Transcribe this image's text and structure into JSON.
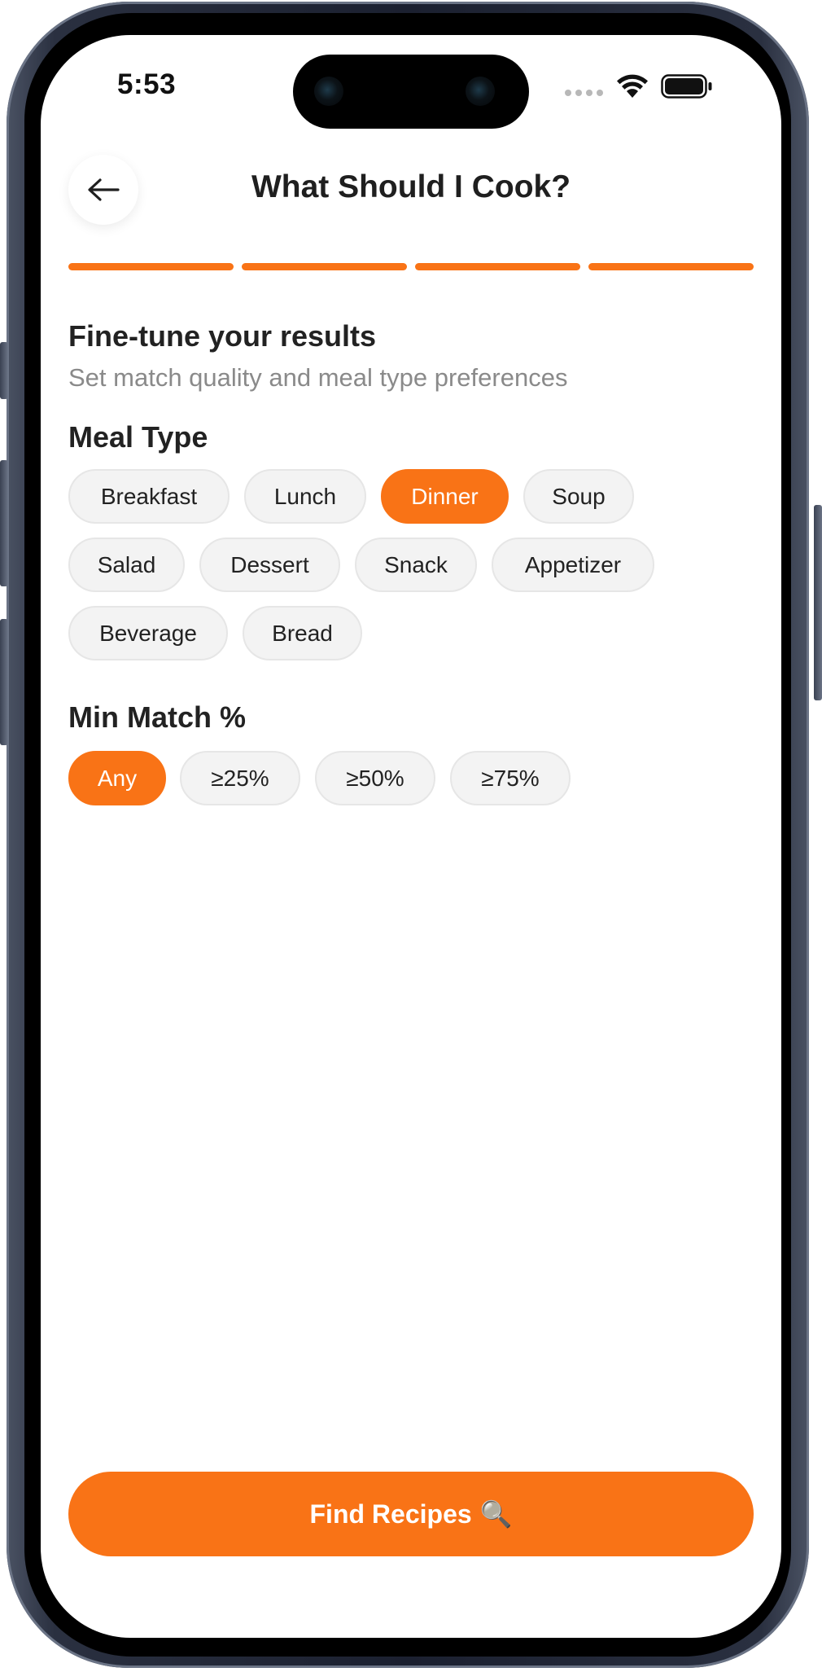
{
  "status_bar": {
    "time": "5:53"
  },
  "header": {
    "title": "What Should I Cook?",
    "back_icon": "arrow-left-icon"
  },
  "progress": {
    "steps_total": 4,
    "steps_completed": 4
  },
  "section": {
    "title": "Fine-tune your results",
    "subtitle": "Set match quality and meal type preferences"
  },
  "meal_type": {
    "label": "Meal Type",
    "selected": "Dinner",
    "options": [
      "Breakfast",
      "Lunch",
      "Dinner",
      "Soup",
      "Salad",
      "Dessert",
      "Snack",
      "Appetizer",
      "Beverage",
      "Bread"
    ]
  },
  "min_match": {
    "label": "Min Match %",
    "selected": "Any",
    "options": [
      "Any",
      "≥25%",
      "≥50%",
      "≥75%"
    ]
  },
  "cta": {
    "label": "Find Recipes",
    "icon": "🔍"
  },
  "colors": {
    "accent": "#f97316",
    "chip_bg": "#f3f3f3",
    "text": "#222222",
    "muted": "#8a8a8a"
  }
}
